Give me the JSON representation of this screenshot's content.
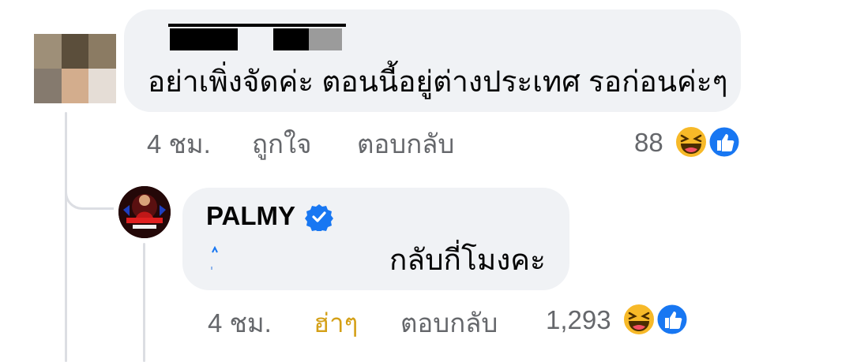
{
  "comment_1": {
    "avatar": "pixelated-blurred-avatar",
    "author_redacted": true,
    "text": "อย่าเพิ่งจัดค่ะ ตอนนี้อยู่ต่างประเทศ รอก่อนค่ะๆ",
    "time": "4 ชม.",
    "like_label": "ถูกใจ",
    "reply_label": "ตอบกลับ",
    "reaction_count": "88",
    "reactions": [
      "haha-icon",
      "like-icon"
    ]
  },
  "comment_2": {
    "avatar": "palmy-profile-avatar",
    "author": "PALMY",
    "verified": true,
    "text": "กลับกี่โมงคะ",
    "time": "4 ชม.",
    "reaction_label": "ฮ่าๆ",
    "reply_label": "ตอบกลับ",
    "reaction_count": "1,293",
    "reactions": [
      "haha-icon",
      "like-icon"
    ]
  },
  "colors": {
    "bubble": "#f0f2f5",
    "meta_text": "#65676b",
    "haha_active": "#d4a017",
    "verified_blue": "#1877f2",
    "like_blue": "#1877f2",
    "haha_yellow": "#f7b928"
  }
}
